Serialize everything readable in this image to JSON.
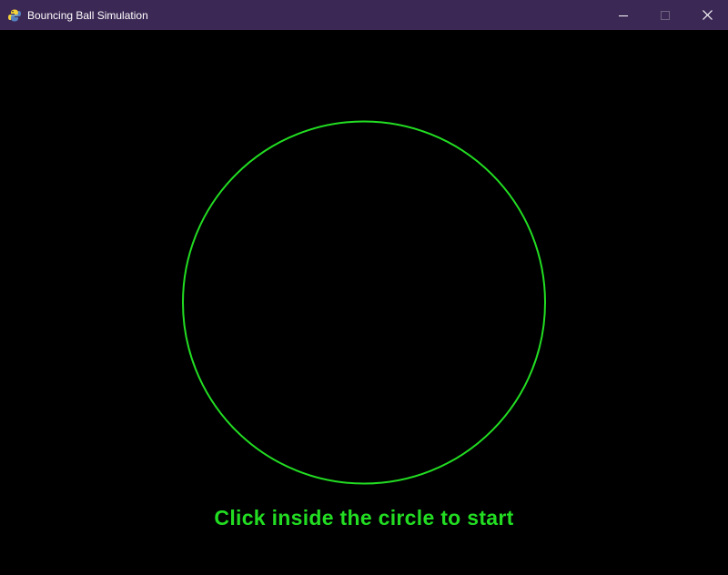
{
  "window": {
    "title": "Bouncing Ball Simulation",
    "icon": "pygame-snake-icon",
    "controls": {
      "minimize": "minimize-icon",
      "maximize": "maximize-icon",
      "close": "close-icon"
    }
  },
  "simulation": {
    "boundary_color": "#22dd22",
    "background_color": "#000000",
    "instruction": "Click inside the circle to start"
  },
  "colors": {
    "titlebar": "#3c2855",
    "accent": "#22dd22"
  }
}
